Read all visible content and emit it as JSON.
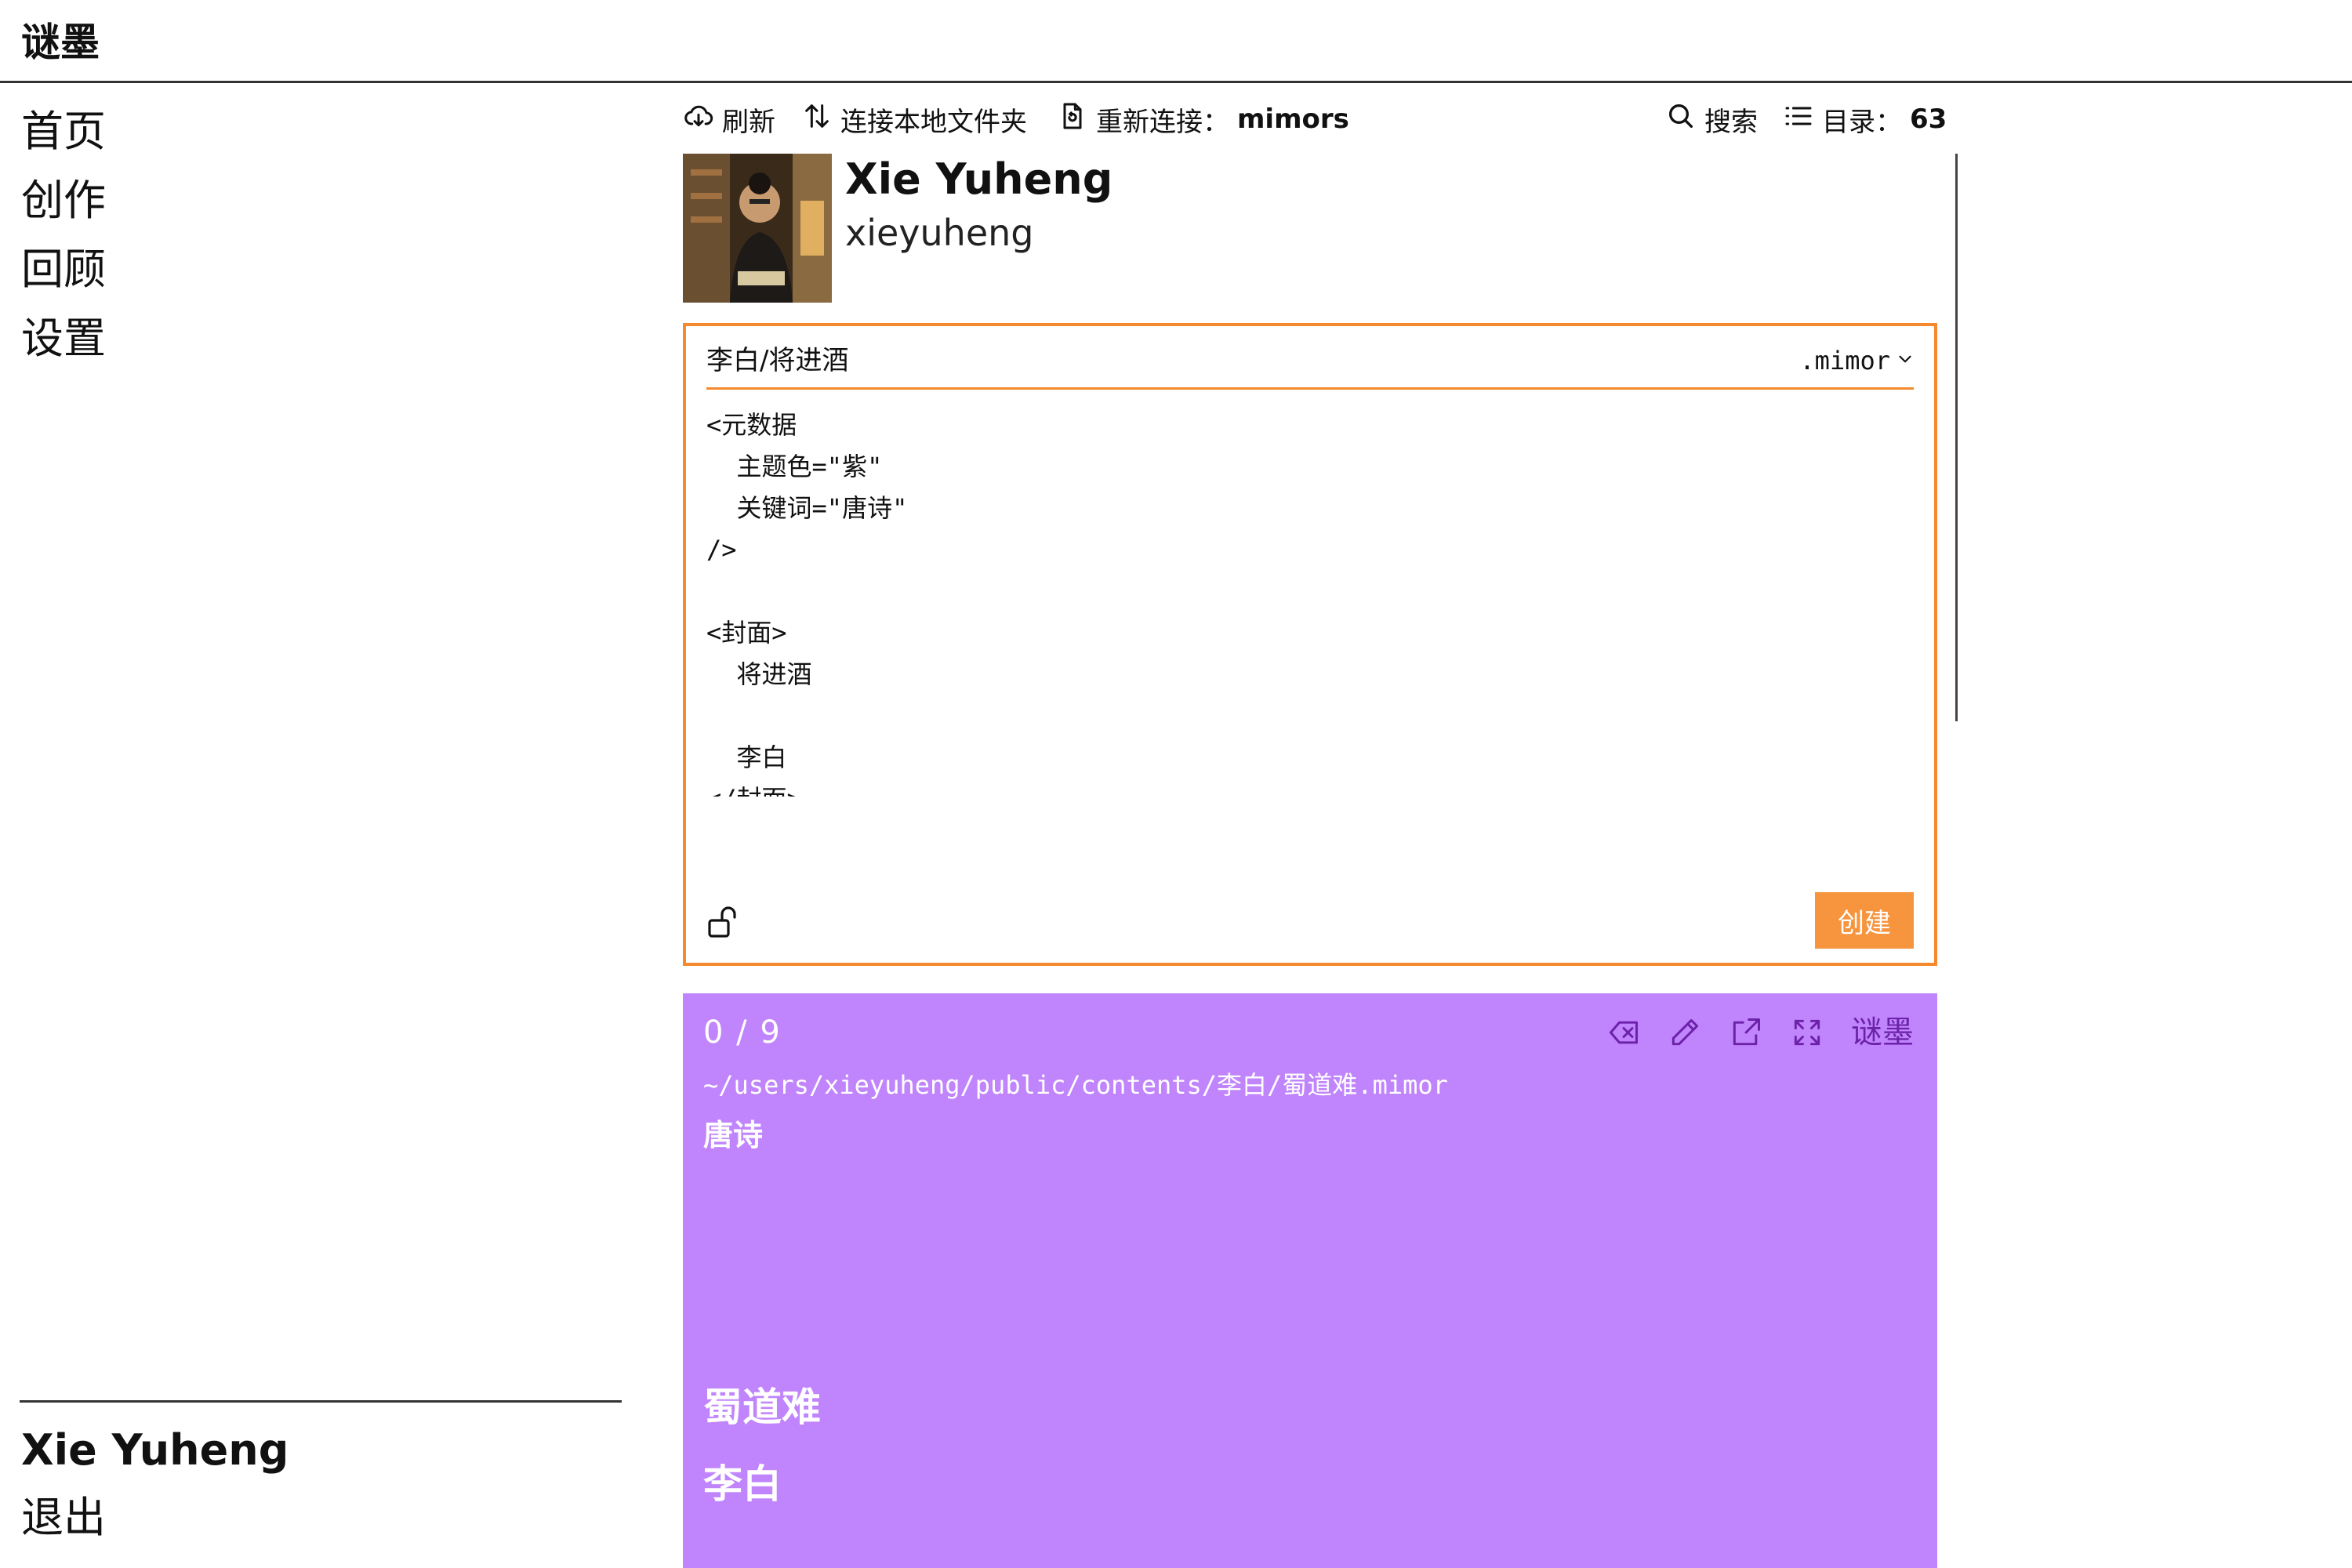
{
  "app": {
    "title": "谜墨"
  },
  "sidebar": {
    "items": [
      {
        "label": "首页"
      },
      {
        "label": "创作"
      },
      {
        "label": "回顾"
      },
      {
        "label": "设置"
      }
    ],
    "user_name": "Xie Yuheng",
    "logout_label": "退出"
  },
  "toolbar": {
    "refresh_label": "刷新",
    "connect_label": "连接本地文件夹",
    "reconnect_label": "重新连接：",
    "reconnect_target": "mimors",
    "search_label": "搜索",
    "toc_label": "目录：",
    "toc_count": "63"
  },
  "profile": {
    "name": "Xie Yuheng",
    "handle": "xieyuheng"
  },
  "editor": {
    "path": "李白/将进酒",
    "extension": ".mimor",
    "content": "<元数据\n  主题色=\"紫\"\n  关键词=\"唐诗\"\n/>\n\n<封面>\n  将进酒\n\n  李白\n</封面>",
    "create_label": "创建"
  },
  "card": {
    "counter": "0 / 9",
    "brand_label": "谜墨",
    "file_path": "~/users/xieyuheng/public/contents/李白/蜀道难.mimor",
    "keyword": "唐诗",
    "cover_title": "蜀道难",
    "cover_author": "李白",
    "background_color": "#c084fc"
  },
  "colors": {
    "accent": "#f5892e",
    "create_button": "#f7953f",
    "card_purple": "#c084fc",
    "card_brand": "#6b21a8"
  },
  "icons": {
    "refresh": "cloud-download-icon",
    "connect": "arrows-up-down-icon",
    "reconnect": "file-refresh-icon",
    "search": "search-icon",
    "toc": "list-icon",
    "lock": "unlock-icon",
    "card_actions": [
      "backspace-icon",
      "pencil-icon",
      "external-link-icon",
      "fullscreen-icon"
    ]
  }
}
